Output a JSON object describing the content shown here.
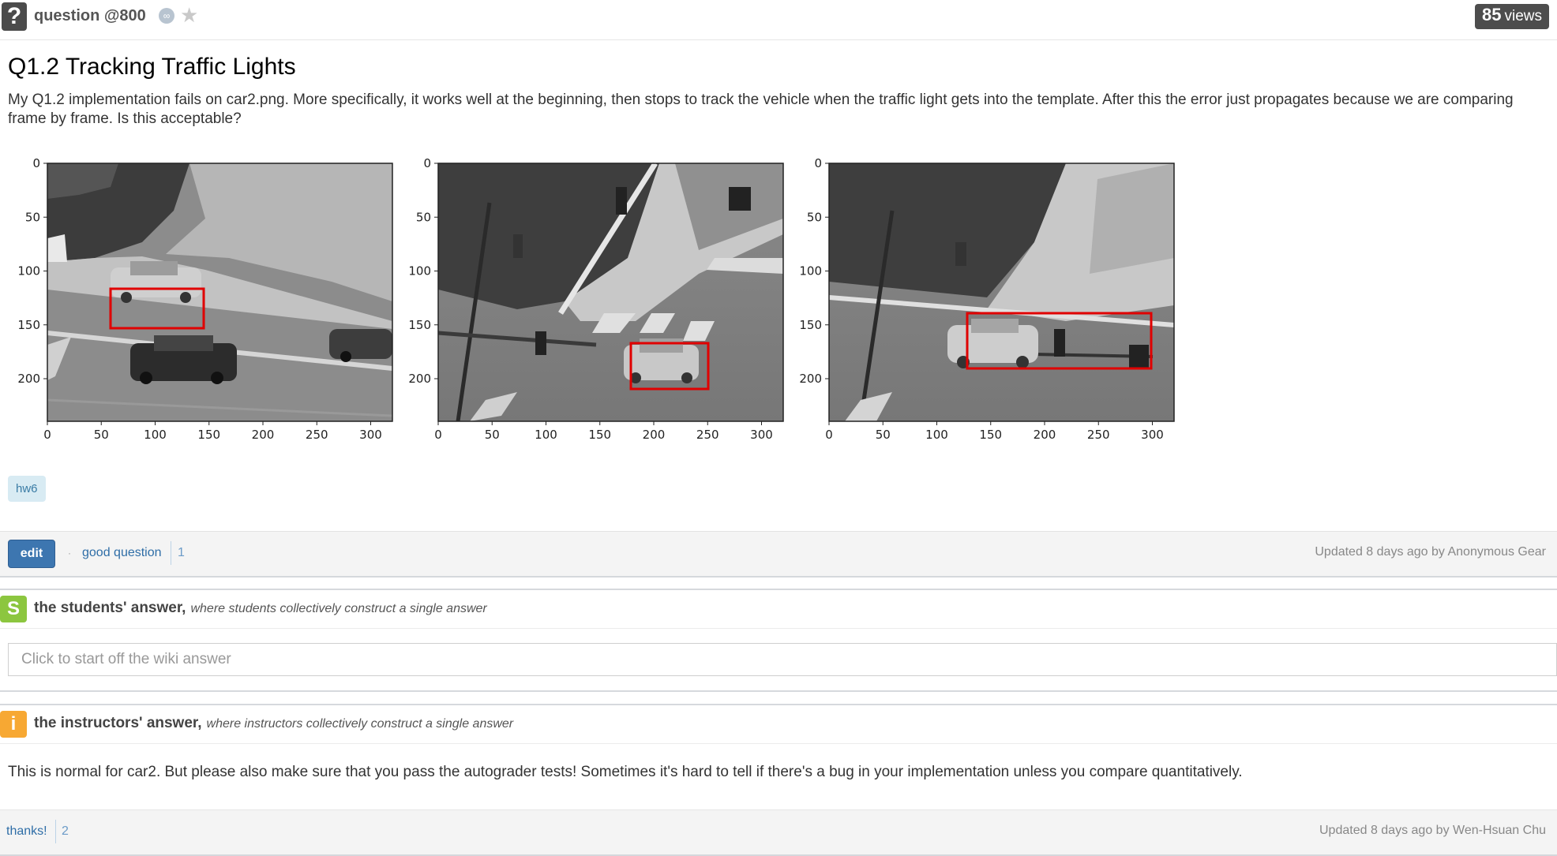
{
  "header": {
    "badge": "?",
    "question_label": "question @800",
    "views_count": "85",
    "views_label": "views"
  },
  "post": {
    "title": "Q1.2 Tracking Traffic Lights",
    "body": "My Q1.2 implementation fails on car2.png. More specifically, it works well at the beginning, then stops to track the vehicle when the traffic light gets into the template. After this the error just propagates because we are comparing frame by frame. Is this acceptable?",
    "figure": {
      "panels": [
        {
          "x_ticks": [
            "0",
            "50",
            "100",
            "150",
            "200",
            "250",
            "300"
          ],
          "y_ticks": [
            "0",
            "50",
            "100",
            "150",
            "200"
          ]
        },
        {
          "x_ticks": [
            "0",
            "50",
            "100",
            "150",
            "200",
            "250",
            "300"
          ],
          "y_ticks": [
            "0",
            "50",
            "100",
            "150",
            "200"
          ]
        },
        {
          "x_ticks": [
            "0",
            "50",
            "100",
            "150",
            "200",
            "250",
            "300"
          ],
          "y_ticks": [
            "0",
            "50",
            "100",
            "150",
            "200"
          ]
        }
      ]
    },
    "tag": "hw6"
  },
  "actions": {
    "edit_label": "edit",
    "good_question_label": "good question",
    "good_question_count": "1",
    "updated_text": "Updated 8 days ago by Anonymous Gear"
  },
  "students_answer": {
    "badge": "S",
    "title": "the students' answer,",
    "subtitle": "where students collectively construct a single answer",
    "placeholder": "Click to start off the wiki answer"
  },
  "instructors_answer": {
    "badge": "i",
    "title": "the instructors' answer,",
    "subtitle": "where instructors collectively construct a single answer",
    "body": "This is normal for car2. But please also make sure that you pass the autograder tests! Sometimes it's hard to tell if there's a bug in your implementation unless you compare quantitatively.",
    "thanks_label": "thanks!",
    "thanks_count": "2",
    "updated_text": "Updated 8 days ago by Wen-Hsuan Chu"
  },
  "colors": {
    "students_badge": "#8cc63f",
    "instructors_badge": "#f7a833",
    "accent": "#3d76b0",
    "box": "#e00000"
  }
}
